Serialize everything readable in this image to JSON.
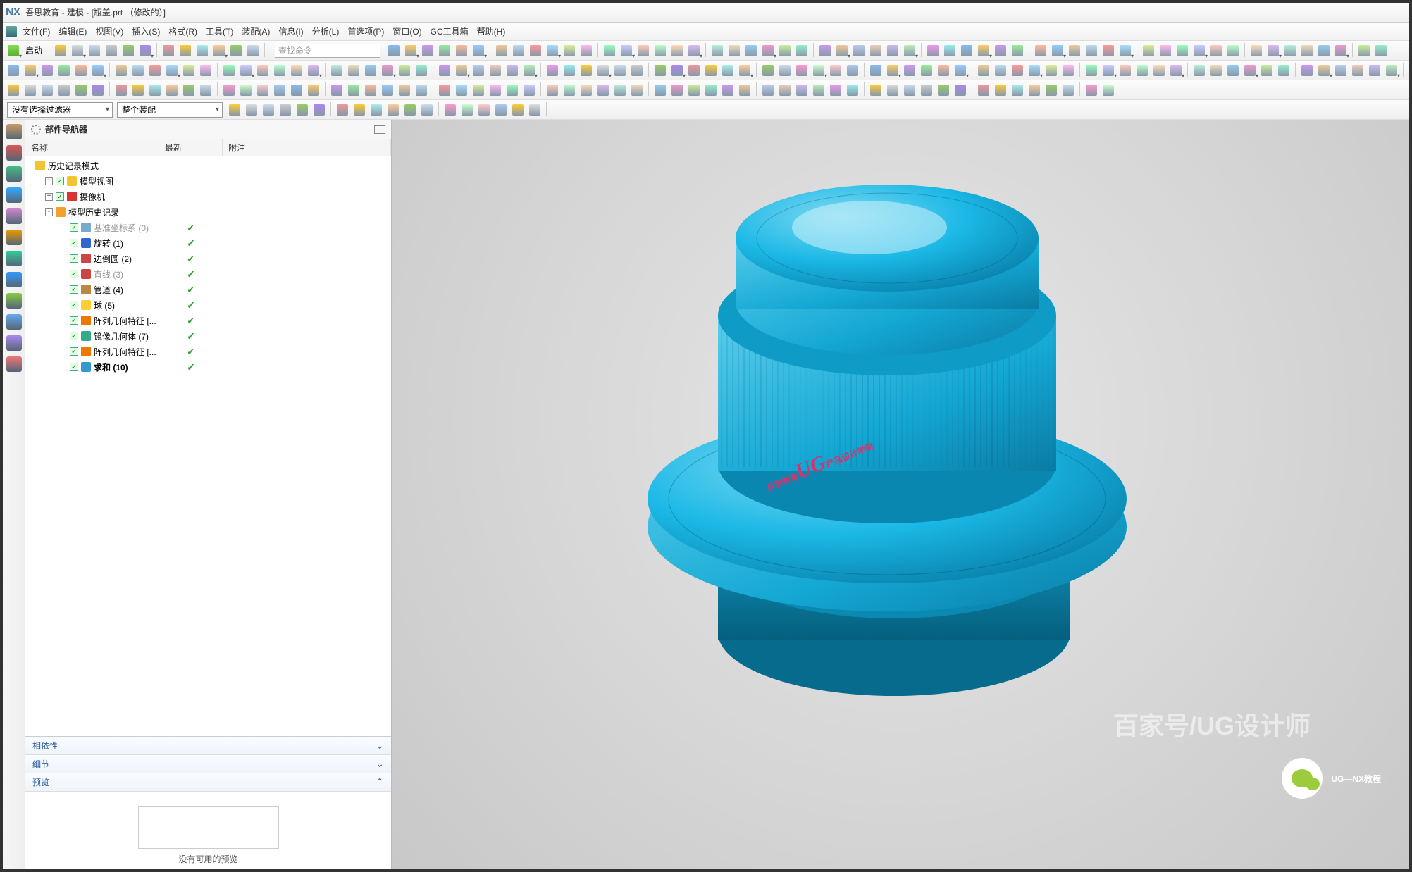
{
  "title": "吾思教育 - 建模 - [瓶盖.prt （修改的）]",
  "app_logo": "NX",
  "menu": [
    "文件(F)",
    "编辑(E)",
    "视图(V)",
    "插入(S)",
    "格式(R)",
    "工具(T)",
    "装配(A)",
    "信息(I)",
    "分析(L)",
    "首选项(P)",
    "窗口(O)",
    "GC工具箱",
    "帮助(H)"
  ],
  "toolbar1": {
    "start": "启动",
    "search_placeholder": "查找命令"
  },
  "filter": {
    "left": "没有选择过滤器",
    "right": "整个装配"
  },
  "navigator": {
    "title": "部件导航器",
    "columns": [
      "名称",
      "最新",
      "附注"
    ],
    "root": "历史记录模式",
    "nodes": [
      {
        "label": "模型视图",
        "exp": "+",
        "chk": true,
        "icon": "#f4c430"
      },
      {
        "label": "摄像机",
        "exp": "+",
        "chk": true,
        "icon": "#d33"
      },
      {
        "label": "模型历史记录",
        "exp": "-",
        "chk": false,
        "icon": "#f4a030",
        "children": [
          {
            "label": "基准坐标系 (0)",
            "chk": true,
            "icon": "#7ac",
            "muted": true,
            "latest": true
          },
          {
            "label": "旋转 (1)",
            "chk": true,
            "icon": "#36c",
            "latest": true
          },
          {
            "label": "边倒圆 (2)",
            "chk": true,
            "icon": "#c44",
            "latest": true
          },
          {
            "label": "直线 (3)",
            "chk": true,
            "icon": "#c44",
            "muted": true,
            "latest": true
          },
          {
            "label": "管道 (4)",
            "chk": true,
            "icon": "#b84",
            "latest": true
          },
          {
            "label": "球 (5)",
            "chk": true,
            "icon": "#fc3",
            "latest": true
          },
          {
            "label": "阵列几何特征 [...",
            "chk": true,
            "icon": "#e70",
            "latest": true
          },
          {
            "label": "镜像几何体 (7)",
            "chk": true,
            "icon": "#3a8",
            "latest": true
          },
          {
            "label": "阵列几何特征 [...",
            "chk": true,
            "icon": "#e70",
            "latest": true
          },
          {
            "label": "求和 (10)",
            "chk": true,
            "icon": "#39c",
            "latest": true,
            "bold": true
          }
        ]
      }
    ],
    "sections": [
      "相依性",
      "细节",
      "预览"
    ],
    "preview_empty": "没有可用的预览"
  },
  "watermark": {
    "pre": "吾思教育",
    "mid": "UG",
    "post": "产品设计学院"
  },
  "wm2": "百家号/UG设计师",
  "wechat": "UG—NX教程",
  "side_colors": [
    "#c96",
    "#d55",
    "#4b8",
    "#3af",
    "#c8c",
    "#e90",
    "#3c9",
    "#39f",
    "#8c4",
    "#6ae",
    "#a8e",
    "#e77"
  ],
  "tb_colors_a": [
    "#fc3",
    "#ddd",
    "#cde",
    "#ccc",
    "#9c6",
    "#a8e",
    "#e99",
    "#fc3",
    "#aee",
    "#fc9",
    "#9c6",
    "#cde",
    "#f9c",
    "#cfc",
    "#fcc",
    "#ace"
  ],
  "tb_colors_b": [
    "#8be",
    "#fc6",
    "#c9e",
    "#9e9",
    "#fb9",
    "#9cf",
    "#ec9",
    "#bde",
    "#f99",
    "#adf",
    "#de9",
    "#fbe",
    "#9fb",
    "#ccf",
    "#fcb",
    "#bfc",
    "#fdb",
    "#dbe",
    "#bed",
    "#edb",
    "#9ce",
    "#e9c",
    "#ce9",
    "#9ec",
    "#c9e",
    "#ec9",
    "#bce",
    "#ecb",
    "#cbe",
    "#beb",
    "#e9e",
    "#9ee"
  ]
}
